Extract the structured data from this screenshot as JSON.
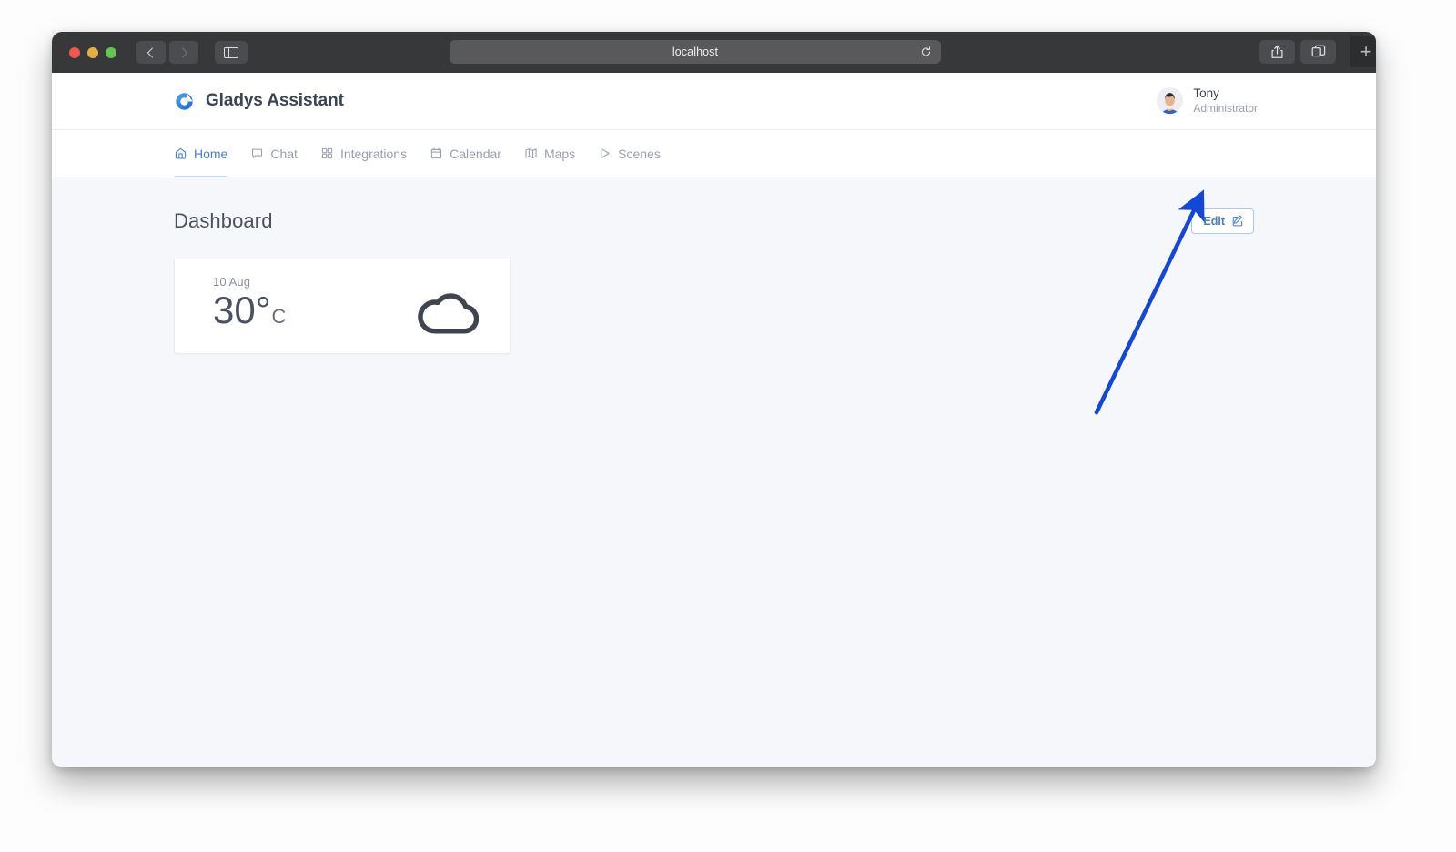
{
  "browser": {
    "url_text": "localhost",
    "traffic_lights": [
      "close",
      "minimize",
      "zoom"
    ],
    "back_label": "Back",
    "forward_label": "Forward",
    "sidebar_label": "Show sidebar",
    "reload_label": "Reload",
    "share_label": "Share",
    "tabs_label": "Tab overview",
    "new_tab_label": "+"
  },
  "app": {
    "brand_title": "Gladys Assistant",
    "user": {
      "name": "Tony",
      "role": "Administrator"
    },
    "nav": [
      {
        "label": "Home",
        "icon": "home-icon",
        "active": true
      },
      {
        "label": "Chat",
        "icon": "chat-icon",
        "active": false
      },
      {
        "label": "Integrations",
        "icon": "integrations-icon",
        "active": false
      },
      {
        "label": "Calendar",
        "icon": "calendar-icon",
        "active": false
      },
      {
        "label": "Maps",
        "icon": "maps-icon",
        "active": false
      },
      {
        "label": "Scenes",
        "icon": "scenes-icon",
        "active": false
      }
    ],
    "page": {
      "title": "Dashboard",
      "edit_label": "Edit"
    },
    "weather_card": {
      "date": "10 Aug",
      "temperature": "30°",
      "unit": "C",
      "condition_icon": "cloud-icon"
    }
  },
  "colors": {
    "accent_blue": "#467fcf",
    "annotation_blue": "#1347d8",
    "page_background": "#f5f7fb",
    "text_dark": "#4b5160",
    "text_muted": "#9aa0ab",
    "titlebar": "#37383a"
  }
}
